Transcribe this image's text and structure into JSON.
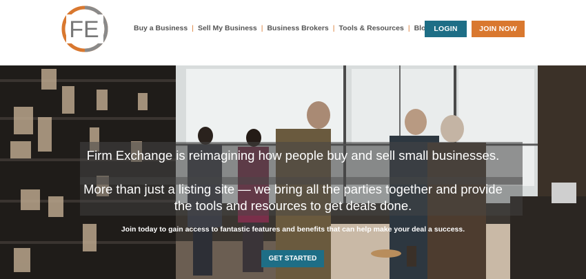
{
  "brand": {
    "logo_text": "FE",
    "logo_colors": {
      "ring": "#d9782f",
      "letters": "#777777"
    }
  },
  "nav": {
    "items": [
      {
        "label": "Buy a Business"
      },
      {
        "label": "Sell My Business"
      },
      {
        "label": "Business Brokers"
      },
      {
        "label": "Tools & Resources"
      },
      {
        "label": "Blog"
      }
    ],
    "separator": "|"
  },
  "auth": {
    "login_label": "LOGIN",
    "join_label": "JOIN NOW"
  },
  "hero": {
    "headline_line1": "Firm Exchange is reimagining how people buy and sell small businesses.",
    "headline_line2": "More than just a listing site — we bring all the parties together and provide",
    "headline_line3": "the tools and resources to get deals done.",
    "subline": "Join today to gain access to fantastic features and benefits that can help make your deal a success.",
    "cta_label": "GET STARTED"
  },
  "colors": {
    "primary": "#1e6e86",
    "accent": "#d9782f",
    "nav_text": "#555555"
  }
}
